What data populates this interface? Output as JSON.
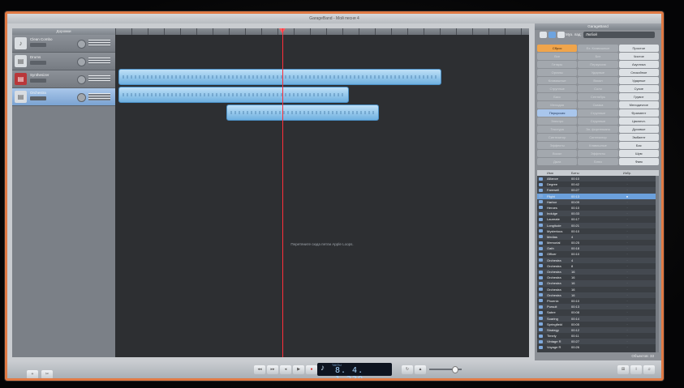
{
  "window": {
    "title": "GarageBand - Мой песня 4"
  },
  "tracks_panel": {
    "header": "Дорожки",
    "tracks": [
      {
        "name": "Clean Combo",
        "icon": "guitar-icon",
        "selected": false,
        "red": false
      },
      {
        "name": "Drums",
        "icon": "keyboard-icon",
        "selected": false,
        "red": false
      },
      {
        "name": "Synthesizer",
        "icon": "synth-icon",
        "selected": false,
        "red": true
      },
      {
        "name": "Orchestra",
        "icon": "keyboard-icon",
        "selected": true,
        "red": false
      }
    ]
  },
  "arrange": {
    "hint": "Перетяните сюда петли Apple Loops."
  },
  "loops": {
    "title": "GarageBand",
    "scale_label": "Муз. лад:",
    "scale_value": "Любой",
    "keywords": [
      [
        "Сброс",
        "Ex. Клавишные",
        "Простое"
      ],
      [
        "Все",
        "Бит",
        "Чистое"
      ],
      [
        "Гитары",
        "Перкуссия",
        "Акустика"
      ],
      [
        "Органы",
        "Ударные",
        "Спокойное"
      ],
      [
        "Клавишные",
        "Вокал",
        "Ударные"
      ],
      [
        "Струнные",
        "Соло",
        "Сухие"
      ],
      [
        "Басс",
        "Сентябрь",
        "Грувит"
      ],
      [
        "Мелодия",
        "Сказка",
        "Мелодичное"
      ],
      [
        "Перкуссия",
        "Струнные",
        "Фрагмент"
      ],
      [
        "Электро",
        "Струнные",
        "Цикличн."
      ],
      [
        "Текстура",
        "Эл. фортепиано",
        "Духовые"
      ],
      [
        "Синтезатор",
        "Синтезатор",
        "Эмбиент"
      ],
      [
        "Эффекты",
        "Клавишные",
        "Бас"
      ],
      [
        "Вокал",
        "Эффекты",
        "Шум"
      ],
      [
        "Джаз",
        "Блюз",
        "Фанк"
      ]
    ],
    "list_columns": [
      "Имя",
      "Биты",
      "Избр."
    ],
    "rows": [
      {
        "name": "Alliance",
        "beats": "00:10",
        "fav": false,
        "sel": false
      },
      {
        "name": "Degree",
        "beats": "00:42",
        "fav": false,
        "sel": false
      },
      {
        "name": "Farewell",
        "beats": "00:27",
        "fav": false,
        "sel": false
      },
      {
        "name": "Flight",
        "beats": "00:13",
        "fav": true,
        "sel": true
      },
      {
        "name": "Harbor",
        "beats": "00:09",
        "fav": false,
        "sel": false
      },
      {
        "name": "Heroes",
        "beats": "00:10",
        "fav": false,
        "sel": false
      },
      {
        "name": "Indulge",
        "beats": "00:33",
        "fav": false,
        "sel": false
      },
      {
        "name": "Laureate",
        "beats": "00:17",
        "fav": false,
        "sel": false
      },
      {
        "name": "Longitude",
        "beats": "00:21",
        "fav": false,
        "sel": false
      },
      {
        "name": "Mysterious",
        "beats": "00:10",
        "fav": false,
        "sel": false
      },
      {
        "name": "Medias",
        "beats": "4",
        "fav": false,
        "sel": false
      },
      {
        "name": "Memorial",
        "beats": "00:25",
        "fav": false,
        "sel": false
      },
      {
        "name": "Oath",
        "beats": "00:18",
        "fav": false,
        "sel": false
      },
      {
        "name": "Officer",
        "beats": "00:10",
        "fav": false,
        "sel": false
      },
      {
        "name": "Orchestra",
        "beats": "4",
        "fav": false,
        "sel": false
      },
      {
        "name": "Orchestra",
        "beats": "8",
        "fav": false,
        "sel": false
      },
      {
        "name": "Orchestra",
        "beats": "16",
        "fav": false,
        "sel": false
      },
      {
        "name": "Orchestra",
        "beats": "16",
        "fav": false,
        "sel": false
      },
      {
        "name": "Orchestra",
        "beats": "16",
        "fav": false,
        "sel": false
      },
      {
        "name": "Orchestra",
        "beats": "16",
        "fav": false,
        "sel": false
      },
      {
        "name": "Orchestra",
        "beats": "16",
        "fav": false,
        "sel": false
      },
      {
        "name": "Phoenix",
        "beats": "00:10",
        "fav": false,
        "sel": false
      },
      {
        "name": "Pursuit",
        "beats": "00:13",
        "fav": false,
        "sel": false
      },
      {
        "name": "Sabre",
        "beats": "00:08",
        "fav": false,
        "sel": false
      },
      {
        "name": "Soaring",
        "beats": "00:14",
        "fav": false,
        "sel": false
      },
      {
        "name": "Springfield",
        "beats": "00:05",
        "fav": false,
        "sel": false
      },
      {
        "name": "Strategy",
        "beats": "00:12",
        "fav": false,
        "sel": false
      },
      {
        "name": "Timely",
        "beats": "00:11",
        "fav": false,
        "sel": false
      },
      {
        "name": "Vintage R",
        "beats": "00:27",
        "fav": false,
        "sel": false
      },
      {
        "name": "Voyage R",
        "beats": "00:26",
        "fav": false,
        "sel": false
      }
    ],
    "footer_count": "Объектов: 33"
  },
  "transport": {
    "buttons": [
      "◂◂",
      "▸▸",
      "◂",
      "▶",
      "●"
    ],
    "lcd_mode": "ТАКТЫ",
    "lcd_time": "8. 4. 1.239"
  }
}
